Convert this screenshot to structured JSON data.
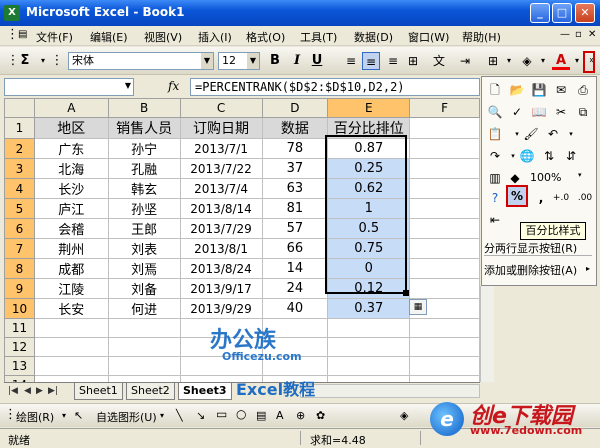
{
  "window": {
    "title": "Microsoft Excel - Book1",
    "min": "_",
    "max": "□",
    "close": "✕"
  },
  "menu": [
    {
      "label": "文件(F)"
    },
    {
      "label": "编辑(E)"
    },
    {
      "label": "视图(V)"
    },
    {
      "label": "插入(I)"
    },
    {
      "label": "格式(O)"
    },
    {
      "label": "工具(T)"
    },
    {
      "label": "数据(D)"
    },
    {
      "label": "窗口(W)"
    },
    {
      "label": "帮助(H)"
    }
  ],
  "toolbar": {
    "sigma": "Σ",
    "font_name": "宋体",
    "font_size": "12",
    "bold": "B",
    "italic": "I",
    "underline": "U",
    "font_color_glyph": "A"
  },
  "formula_bar": {
    "fx": "fx",
    "formula": "=PERCENTRANK($D$2:$D$10,D2,2)"
  },
  "sheet": {
    "columns": [
      "A",
      "B",
      "C",
      "D",
      "E",
      "F"
    ],
    "rows": [
      "1",
      "2",
      "3",
      "4",
      "5",
      "6",
      "7",
      "8",
      "9",
      "10",
      "11",
      "12",
      "13",
      "14"
    ],
    "header": [
      "地区",
      "销售人员",
      "订购日期",
      "数据",
      "百分比排位"
    ],
    "data": [
      [
        "广东",
        "孙宁",
        "2013/7/1",
        "78",
        "0.87"
      ],
      [
        "北海",
        "孔融",
        "2013/7/22",
        "37",
        "0.25"
      ],
      [
        "长沙",
        "韩玄",
        "2013/7/4",
        "63",
        "0.62"
      ],
      [
        "庐江",
        "孙坚",
        "2013/8/14",
        "81",
        "1"
      ],
      [
        "会稽",
        "王郎",
        "2013/7/29",
        "57",
        "0.5"
      ],
      [
        "荆州",
        "刘表",
        "2013/8/1",
        "66",
        "0.75"
      ],
      [
        "成都",
        "刘焉",
        "2013/8/24",
        "14",
        "0"
      ],
      [
        "江陵",
        "刘备",
        "2013/9/17",
        "24",
        "0.12"
      ],
      [
        "长安",
        "何进",
        "2013/9/29",
        "40",
        "0.37"
      ]
    ]
  },
  "popup_toolbar": {
    "zoom": "100%",
    "percent_button": "%",
    "comma_button": ",",
    "increase_decimal": "+.0",
    "decrease_decimal": ".00",
    "tooltip": "百分比样式",
    "partial_item": "分两行显示按钮(R)",
    "add_remove": "添加或删除按钮(A)"
  },
  "tabs": {
    "sheets": [
      "Sheet1",
      "Sheet2",
      "Sheet3"
    ],
    "active": 2
  },
  "draw_toolbar": {
    "draw": "绘图(R)",
    "autoshapes": "自选图形(U)"
  },
  "status": {
    "left": "就绪",
    "sum": "求和=4.48"
  },
  "watermarks": {
    "bangongzu": "办公族",
    "officezu": "Officezu.com",
    "excel_tutorial": "Excel教程",
    "site_title": "创e下载园",
    "site_url": "www.7edown.com"
  }
}
